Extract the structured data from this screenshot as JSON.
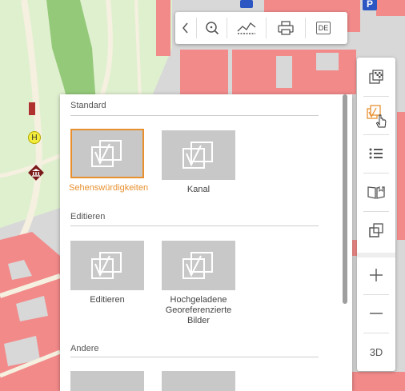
{
  "map": {
    "parking_label": "P",
    "helipad_label": "H"
  },
  "top_toolbar": {
    "buttons": [
      {
        "name": "collapse",
        "icon": "chevron-left-icon"
      },
      {
        "name": "zoom",
        "icon": "zoom-icon"
      },
      {
        "name": "elevation-profile",
        "icon": "profile-chart-icon"
      },
      {
        "name": "print",
        "icon": "printer-icon"
      },
      {
        "name": "language",
        "icon": "language-badge",
        "label": "DE"
      }
    ]
  },
  "right_toolbar": {
    "buttons": [
      {
        "name": "overlays",
        "icon": "layers-checker-icon"
      },
      {
        "name": "basemap",
        "icon": "basemap-check-icon",
        "active": true,
        "active_color": "#e8902e"
      },
      {
        "name": "legend",
        "icon": "list-icon"
      },
      {
        "name": "manual",
        "icon": "book-icon"
      },
      {
        "name": "compare",
        "icon": "stacked-windows-icon"
      },
      {
        "name": "zoom-in",
        "icon": "plus-icon"
      },
      {
        "name": "zoom-out",
        "icon": "minus-icon"
      }
    ],
    "label_3d": "3D"
  },
  "basemap_panel": {
    "sections": [
      {
        "title": "Standard",
        "items": [
          {
            "label": "Sehenswürdigkeiten",
            "active": true
          },
          {
            "label": "Kanal",
            "active": false
          }
        ]
      },
      {
        "title": "Editieren",
        "items": [
          {
            "label": "Editieren",
            "active": false
          },
          {
            "label": "Hochgeladene Georeferenzierte Bilder",
            "active": false
          }
        ]
      },
      {
        "title": "Andere",
        "items": []
      }
    ],
    "accent_color": "#e8902e"
  }
}
